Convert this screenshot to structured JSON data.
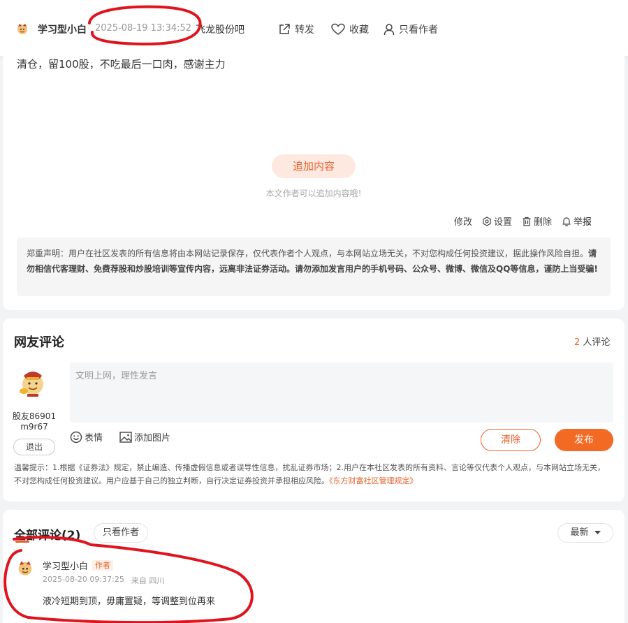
{
  "header": {
    "author": "学习型小白",
    "time": "2025-08-19 13:34:52",
    "bar_name": "飞龙股份吧",
    "forward": "转发",
    "favorite": "收藏",
    "only_author": "只看作者"
  },
  "post": {
    "content": "清仓，留100股，不吃最后一口肉，感谢主力",
    "add_content": "追加内容",
    "add_hint": "本文作者可以追加内容哦!",
    "actions": {
      "edit": "修改",
      "settings": "设置",
      "delete": "删除",
      "report": "举报"
    }
  },
  "notice": {
    "normal": "郑重声明：用户在社区发表的所有信息将由本网站记录保存，仅代表作者个人观点，与本网站立场无关，不对您构成任何投资建议，据此操作风险自担。",
    "bold": "请勿相信代客理财、免费荐股和炒股培训等宣传内容，远离非法证券活动。请勿添加发言用户的手机号码、公众号、微博、微信及QQ等信息，谨防上当受骗!"
  },
  "comments_box": {
    "title": "网友评论",
    "count": "2",
    "count_suffix": " 人评论",
    "placeholder": "文明上网，理性发言",
    "user_name": "股友86901m9r67",
    "logout": "退出",
    "emoji": "表情",
    "add_image": "添加图片",
    "clear": "清除",
    "publish": "发布",
    "tips": "温馨提示：1.根据《证券法》规定，禁止编造、传播虚假信息或者误导性信息，扰乱证券市场；2.用户在本社区发表的所有资料、言论等仅代表个人观点，与本网站立场无关，不对您构成任何投资建议。用户应基于自己的独立判断，自行决定证券投资并承担相应风险。",
    "tips_link": "《东方财富社区管理规定》"
  },
  "all_comments": {
    "title": "全部评论(2)",
    "only_author": "只看作者",
    "sort": "最新",
    "items": [
      {
        "name": "学习型小白",
        "tag": "作者",
        "time": "2025-08-20 09:37:25",
        "location": "来自 四川",
        "text": "液冷短期到顶，毋庸置疑，等调整到位再来"
      }
    ]
  },
  "colors": {
    "accent": "#f26a23",
    "annotation_red": "#e0141e"
  }
}
